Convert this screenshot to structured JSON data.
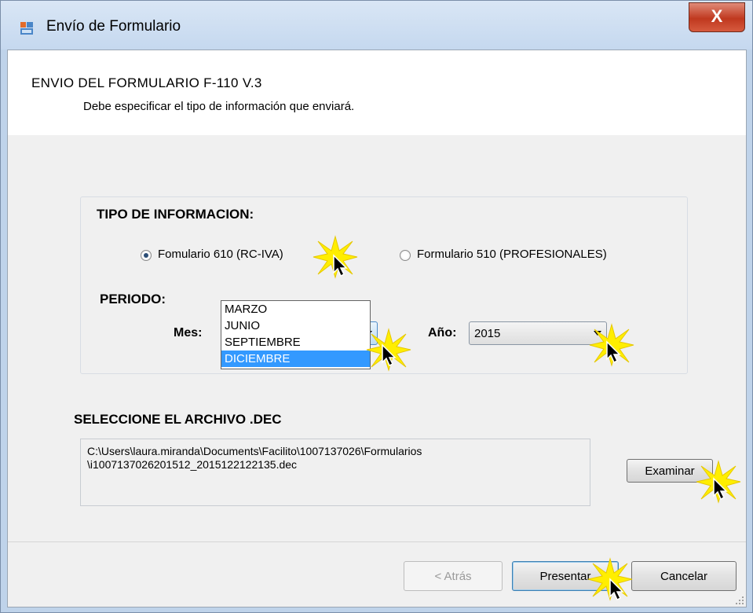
{
  "window": {
    "title": "Envío de Formulario",
    "close_label": "X"
  },
  "header": {
    "title": "ENVIO DEL FORMULARIO F-110 V.3",
    "subtitle": "Debe especificar el tipo de información que enviará."
  },
  "tipo": {
    "label": "TIPO DE INFORMACION:",
    "options": [
      {
        "label": "Fomulario 610 (RC-IVA)",
        "selected": true
      },
      {
        "label": "Formulario 510 (PROFESIONALES)",
        "selected": false
      }
    ]
  },
  "periodo": {
    "label": "PERIODO:",
    "mes_label": "Mes:",
    "mes_value": "",
    "anio_label": "Año:",
    "anio_value": "2015",
    "mes_options": [
      "MARZO",
      "JUNIO",
      "SEPTIEMBRE",
      "DICIEMBRE"
    ],
    "mes_highlighted": "DICIEMBRE"
  },
  "archivo": {
    "label": "SELECCIONE EL ARCHIVO .DEC",
    "path_line1": "C:\\Users\\laura.miranda\\Documents\\Facilito\\1007137026\\Formularios",
    "path_line2": "\\i1007137026201512_2015122122135.dec",
    "browse_label": "Examinar"
  },
  "buttons": {
    "back": "< Atrás",
    "submit": "Presentar",
    "cancel": "Cancelar"
  },
  "colors": {
    "highlight": "#3399ff",
    "burst": "#ffee00",
    "client_bg": "#f0f0f0"
  },
  "icons": [
    "app-icon",
    "close-icon",
    "chevron-down-icon",
    "cursor-icon",
    "highlight-burst-icon"
  ]
}
